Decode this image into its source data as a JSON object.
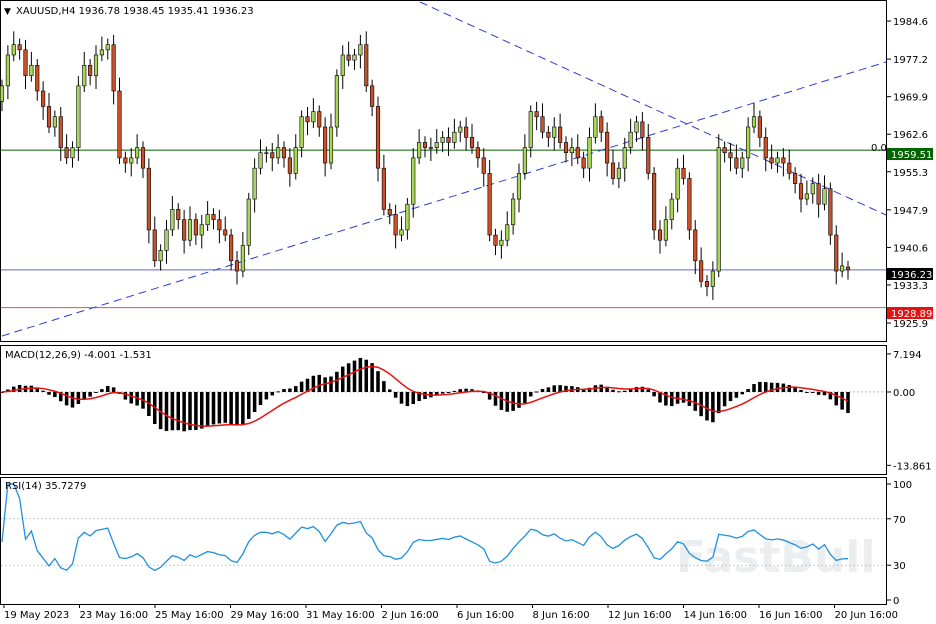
{
  "price_panel": {
    "header": "XAUUSD,H4  1936.78 1938.45 1935.41 1936.23",
    "fib_label": "0.0",
    "green_line_label": "1959.51",
    "blue_line_label": "1936.23",
    "red_line_label": "1928.89",
    "green_line_color": "#006400",
    "blue_line_color": "#6666cc",
    "red_line_color": "#e05050"
  },
  "macd_panel": {
    "header": "MACD(12,26,9) -4.001 -1.531"
  },
  "rsi_panel": {
    "header": "RSI(14) 35.7279"
  },
  "watermark": "FastBull",
  "colors": {
    "bull": "#a8d65a",
    "bear": "#c8502a",
    "signal": "#e81010",
    "rsi": "#1f90e0",
    "trendline": "#2a3fd6"
  },
  "chart_data": [
    {
      "type": "candlestick",
      "symbol": "XAUUSD",
      "timeframe": "H4",
      "title": "XAUUSD,H4",
      "ohlc_last": {
        "open": 1936.78,
        "high": 1938.45,
        "low": 1935.41,
        "close": 1936.23
      },
      "y_ticks": [
        1984.6,
        1977.2,
        1969.9,
        1962.6,
        1955.3,
        1947.9,
        1940.6,
        1933.3,
        1925.9
      ],
      "ylim": [
        1922.6,
        1988.3
      ],
      "x_ticks": [
        "19 May 2023",
        "23 May 16:00",
        "25 May 16:00",
        "29 May 16:00",
        "31 May 16:00",
        "2 Jun 16:00",
        "6 Jun 16:00",
        "8 Jun 16:00",
        "12 Jun 16:00",
        "14 Jun 16:00",
        "16 Jun 16:00",
        "20 Jun 16:00"
      ],
      "horizontal_lines": [
        1959.51,
        1936.23,
        1928.89
      ],
      "closes": [
        1972,
        1978,
        1980,
        1979,
        1974,
        1976,
        1971,
        1968,
        1964,
        1966,
        1960,
        1958,
        1960,
        1972,
        1976,
        1974,
        1978,
        1979,
        1980,
        1971,
        1958,
        1957,
        1958,
        1960,
        1956,
        1944,
        1938,
        1940,
        1944,
        1948,
        1946,
        1942,
        1946,
        1943,
        1945,
        1947,
        1946,
        1944,
        1943,
        1938,
        1936,
        1941,
        1950,
        1956,
        1959,
        1959,
        1958,
        1960,
        1958,
        1955,
        1960,
        1966,
        1965,
        1967,
        1964,
        1957,
        1964,
        1974,
        1978,
        1977,
        1978,
        1980,
        1972,
        1968,
        1956,
        1948,
        1947,
        1943,
        1944,
        1949,
        1958,
        1961,
        1960,
        1960,
        1961,
        1962,
        1961,
        1963,
        1964,
        1962,
        1960,
        1958,
        1955,
        1943,
        1941,
        1942,
        1945,
        1950,
        1955,
        1960,
        1967,
        1966,
        1963,
        1962,
        1964,
        1961,
        1959,
        1960,
        1958,
        1956,
        1962,
        1966,
        1963,
        1957,
        1954,
        1956,
        1960,
        1963,
        1965,
        1962,
        1955,
        1944,
        1942,
        1946,
        1950,
        1956,
        1954,
        1944,
        1938,
        1934,
        1933,
        1936,
        1960,
        1959,
        1958,
        1956,
        1958,
        1964,
        1966,
        1962,
        1958,
        1957,
        1958,
        1957,
        1955,
        1953,
        1950,
        1951,
        1953,
        1949,
        1952,
        1943,
        1936,
        1937,
        1936.23
      ]
    },
    {
      "type": "bar",
      "title": "MACD(12,26,9)",
      "y_ticks": [
        7.194,
        0.0,
        -13.861
      ],
      "ylim": [
        -15.5,
        8.5
      ],
      "values_macd": -4.001,
      "values_signal": -1.531
    },
    {
      "type": "line",
      "title": "RSI(14)",
      "y_ticks": [
        100,
        70,
        30,
        0
      ],
      "ylim": [
        0,
        100
      ],
      "last_value": 35.7279,
      "levels": [
        70,
        30
      ]
    }
  ]
}
